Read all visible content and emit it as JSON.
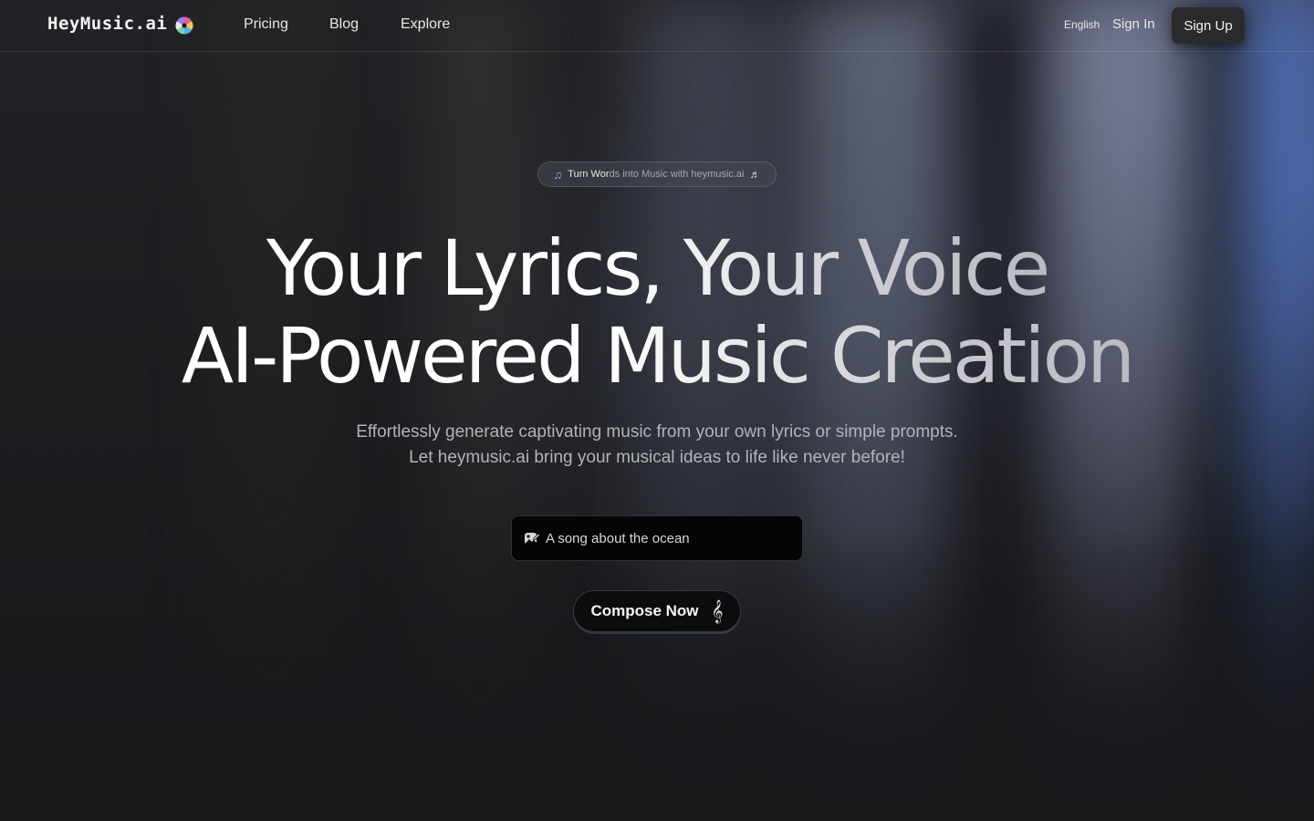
{
  "brand": {
    "name": "HeyMusic.ai",
    "logo_icon": "color-disc-icon"
  },
  "nav": {
    "links": [
      "Pricing",
      "Blog",
      "Explore"
    ],
    "language": "English",
    "sign_in": "Sign In",
    "sign_up": "Sign Up"
  },
  "hero": {
    "badge": {
      "prefix_icon": "music-note-icon",
      "text_strong": "Turn Wor",
      "text_rest": "ds into Music with heymusic.ai",
      "suffix_icon": "double-music-note-icon"
    },
    "title_line1": "Your Lyrics, Your Voice",
    "title_line2": "AI-Powered Music Creation",
    "subtitle_line1": "Effortlessly generate captivating music from your own lyrics or simple prompts.",
    "subtitle_line2": "Let heymusic.ai bring your musical ideas to life like never before!",
    "prompt": {
      "placeholder": "A song about the ocean",
      "icon": "image-pen-icon"
    },
    "cta": {
      "label": "Compose Now",
      "icon": "treble-clef-icon"
    }
  },
  "colors": {
    "background": "#18181b",
    "accent_blue": "#4a6fc8",
    "text_primary": "#ffffff",
    "text_muted": "#b3b3b8"
  }
}
